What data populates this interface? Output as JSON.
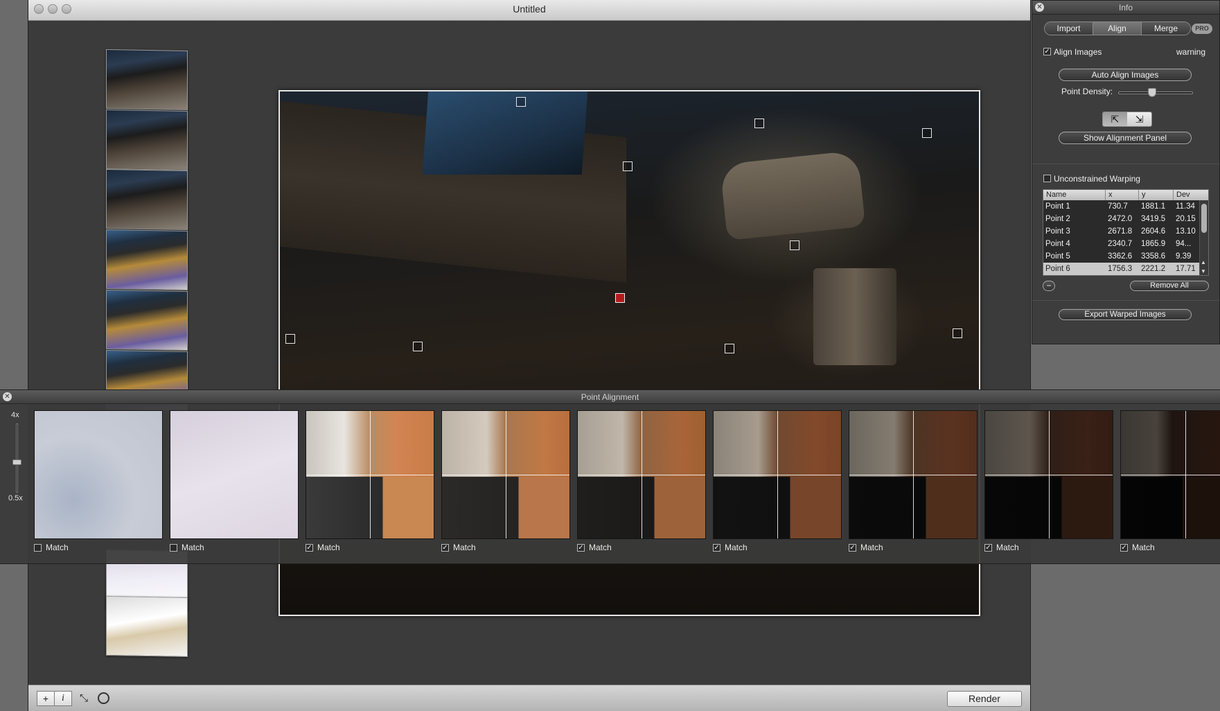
{
  "window": {
    "title": "Untitled"
  },
  "bottom_bar": {
    "add_label": "+",
    "info_label": "i",
    "render_label": "Render"
  },
  "info_panel": {
    "title": "Info",
    "tabs": [
      {
        "label": "Import"
      },
      {
        "label": "Align"
      },
      {
        "label": "Merge"
      }
    ],
    "pro_badge": "PRO",
    "align_images_label": "Align Images",
    "align_images_checked": true,
    "warning_label": "warning",
    "auto_align_label": "Auto Align Images",
    "point_density_label": "Point Density:",
    "point_density_value": 0.45,
    "show_alignment_panel_label": "Show Alignment Panel",
    "unconstrained_warping_label": "Unconstrained Warping",
    "unconstrained_warping_checked": false,
    "table": {
      "headers": {
        "name": "Name",
        "x": "x",
        "y": "y",
        "dev": "Dev"
      },
      "rows": [
        {
          "name": "Point 1",
          "x": "730.7",
          "y": "1881.1",
          "dev": "11.34"
        },
        {
          "name": "Point 2",
          "x": "2472.0",
          "y": "3419.5",
          "dev": "20.15"
        },
        {
          "name": "Point 3",
          "x": "2671.8",
          "y": "2604.6",
          "dev": "13.10"
        },
        {
          "name": "Point 4",
          "x": "2340.7",
          "y": "1865.9",
          "dev": "94..."
        },
        {
          "name": "Point 5",
          "x": "3362.6",
          "y": "3358.6",
          "dev": "9.39"
        },
        {
          "name": "Point 6",
          "x": "1756.3",
          "y": "2221.2",
          "dev": "17.71"
        }
      ]
    },
    "remove_label": "−",
    "remove_all_label": "Remove All",
    "export_label": "Export Warped Images"
  },
  "alignment_panel": {
    "title": "Point Alignment",
    "zoom_max": "4x",
    "zoom_min": "0.5x",
    "match_label": "Match",
    "tiles": [
      {
        "checked": false
      },
      {
        "checked": false
      },
      {
        "checked": true
      },
      {
        "checked": true
      },
      {
        "checked": true
      },
      {
        "checked": true
      },
      {
        "checked": true
      },
      {
        "checked": true
      },
      {
        "checked": true
      }
    ]
  },
  "colors": {
    "accent_marker": "#b31b1b",
    "panel_bg": "#3d3d3d"
  }
}
